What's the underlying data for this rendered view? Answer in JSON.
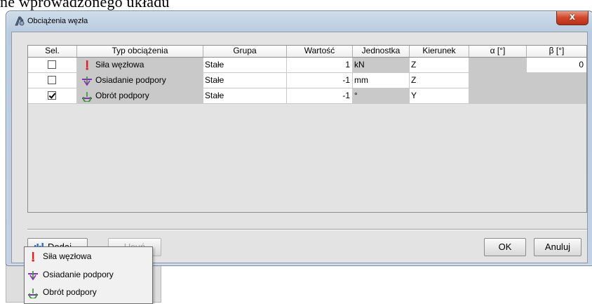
{
  "background": {
    "text": "ne wprowadzonego układu"
  },
  "window": {
    "title": "Obciążenia węzła",
    "close_glyph": "x"
  },
  "table": {
    "headers": {
      "sel": "Sel.",
      "type": "Typ obciążenia",
      "group": "Grupa",
      "value": "Wartość",
      "unit": "Jednostka",
      "direction": "Kierunek",
      "alpha": "α [°]",
      "beta": "β [°]"
    },
    "rows": [
      {
        "selected": false,
        "icon": "force-icon",
        "type": "Siła węzłowa",
        "group": "Stałe",
        "value": "1",
        "unit": "kN",
        "direction": "Z",
        "alpha": "",
        "beta": "0"
      },
      {
        "selected": false,
        "icon": "support-settlement-icon",
        "type": "Osiadanie podpory",
        "group": "Stałe",
        "value": "-1",
        "unit": "mm",
        "direction": "Z",
        "alpha": "",
        "beta": ""
      },
      {
        "selected": true,
        "icon": "support-rotation-icon",
        "type": "Obrót podpory",
        "group": "Stałe",
        "value": "-1",
        "unit": "°",
        "direction": "Y",
        "alpha": "",
        "beta": ""
      }
    ]
  },
  "buttons": {
    "add": "Dodaj",
    "remove": "Usuń",
    "ok": "OK",
    "cancel": "Anuluj"
  },
  "menu": {
    "items": [
      {
        "label": "Siła węzłowa",
        "icon": "force-icon"
      },
      {
        "label": "Osiadanie podpory",
        "icon": "support-settlement-icon"
      },
      {
        "label": "Obrót podpory",
        "icon": "support-rotation-icon"
      }
    ]
  },
  "colors": {
    "title_gradient": "#c3d4e6",
    "close_button": "#d2472b",
    "readonly_cell": "#c9c9c9",
    "force_icon": "#e02020",
    "settlement_icon": "#8a2ab8",
    "rotation_icon": "#2a9a2a"
  }
}
